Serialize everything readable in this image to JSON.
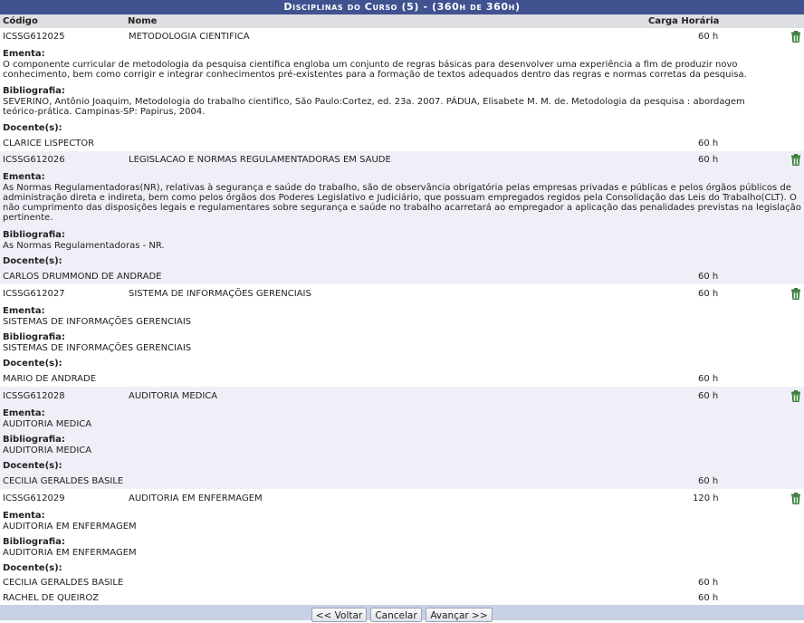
{
  "caption": "Disciplinas do Curso (5) - (360h de 360h)",
  "headers": {
    "codigo": "Código",
    "nome": "Nome",
    "carga": "Carga Horária"
  },
  "labels": {
    "ementa": "Ementa:",
    "bibliografia": "Bibliografia:",
    "docentes": "Docente(s):"
  },
  "disciplinas": [
    {
      "codigo": "ICSSG612025",
      "nome": "METODOLOGIA CIENTIFICA",
      "carga": "60 h",
      "ementa": "O componente curricular de metodologia da pesquisa cientifica engloba um conjunto de regras básicas para desenvolver uma experiência a fim de produzir novo conhecimento, bem como corrigir e integrar conhecimentos pré-existentes para a formação de textos adequados dentro das regras e normas corretas da pesquisa.",
      "bibliografia": "SEVERINO, Antônio Joaquim, Metodologia do trabalho cientifico, São Paulo:Cortez, ed. 23a. 2007. PÁDUA, Elisabete M. M. de. Metodologia da pesquisa : abordagem teórico-prática. Campinas-SP: Papirus, 2004.",
      "docentes": [
        {
          "nome": "CLARICE LISPECTOR",
          "carga": "60 h"
        }
      ]
    },
    {
      "codigo": "ICSSG612026",
      "nome": "LEGISLACAO E NORMAS REGULAMENTADORAS EM SAUDE",
      "carga": "60 h",
      "ementa": "As Normas Regulamentadoras(NR), relativas à segurança e saúde do trabalho, são de observância obrigatória pelas empresas privadas e públicas e pelos órgãos públicos de administração direta e indireta, bem como pelos órgãos dos Poderes Legislativo e Judiciário, que possuam empregados regidos pela Consolidação das Leis do Trabalho(CLT). O não cumprimento das disposições legais e regulamentares sobre segurança e saúde no trabalho acarretará ao empregador a aplicação das penalidades previstas na legislação pertinente.",
      "bibliografia": "As Normas Regulamentadoras - NR.",
      "docentes": [
        {
          "nome": "CARLOS DRUMMOND DE ANDRADE",
          "carga": "60 h"
        }
      ]
    },
    {
      "codigo": "ICSSG612027",
      "nome": "SISTEMA DE INFORMAÇÕES GERENCIAIS",
      "carga": "60 h",
      "ementa": "SISTEMAS DE INFORMAÇÕES GERENCIAIS",
      "bibliografia": "SISTEMAS DE INFORMAÇÕES GERENCIAIS",
      "docentes": [
        {
          "nome": "MARIO DE ANDRADE",
          "carga": "60 h"
        }
      ]
    },
    {
      "codigo": "ICSSG612028",
      "nome": "AUDITORIA MEDICA",
      "carga": "60 h",
      "ementa": "AUDITORIA MEDICA",
      "bibliografia": "AUDITORIA MEDICA",
      "docentes": [
        {
          "nome": "CECILIA GERALDES BASILE",
          "carga": "60 h"
        }
      ]
    },
    {
      "codigo": "ICSSG612029",
      "nome": "AUDITORIA EM ENFERMAGEM",
      "carga": "120 h",
      "ementa": "AUDITORIA EM ENFERMAGEM",
      "bibliografia": "AUDITORIA EM ENFERMAGEM",
      "docentes": [
        {
          "nome": "CECILIA GERALDES BASILE",
          "carga": "60 h"
        },
        {
          "nome": "RACHEL DE QUEIROZ",
          "carga": "60 h"
        }
      ]
    }
  ],
  "buttons": {
    "voltar": "<< Voltar",
    "cancelar": "Cancelar",
    "avancar": "Avançar >>"
  },
  "icons": {
    "remove": "trash-icon"
  }
}
